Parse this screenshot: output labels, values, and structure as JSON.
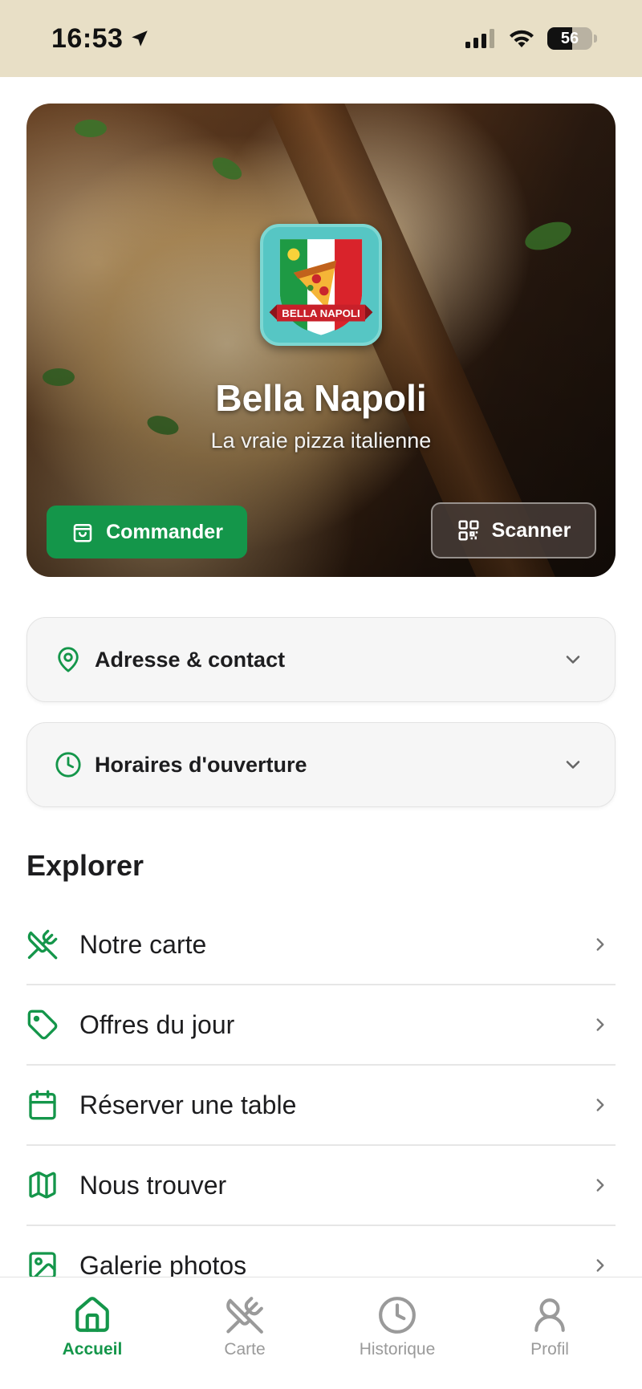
{
  "status_bar": {
    "time": "16:53",
    "battery": "56",
    "battery_level": 0.56
  },
  "hero": {
    "logo_text": "BELLA NAPOLI",
    "title": "Bella Napoli",
    "subtitle": "La vraie pizza italienne",
    "order_button": "Commander",
    "scan_button": "Scanner"
  },
  "info": {
    "address_label": "Adresse & contact",
    "hours_label": "Horaires d'ouverture"
  },
  "explorer": {
    "title": "Explorer",
    "items": [
      {
        "label": "Notre carte",
        "icon": "utensils-crossed-icon"
      },
      {
        "label": "Offres du jour",
        "icon": "tag-icon"
      },
      {
        "label": "Réserver une table",
        "icon": "calendar-icon"
      },
      {
        "label": "Nous trouver",
        "icon": "map-icon"
      },
      {
        "label": "Galerie photos",
        "icon": "image-icon"
      }
    ]
  },
  "tab_bar": {
    "tabs": [
      {
        "label": "Accueil",
        "icon": "home-icon",
        "active": true
      },
      {
        "label": "Carte",
        "icon": "utensils-crossed-icon",
        "active": false
      },
      {
        "label": "Historique",
        "icon": "clock-icon",
        "active": false
      },
      {
        "label": "Profil",
        "icon": "user-icon",
        "active": false
      }
    ]
  },
  "colors": {
    "accent": "#14964a",
    "status_bar_bg": "#e8dfc6",
    "inactive_tab": "#9a9a9a"
  }
}
